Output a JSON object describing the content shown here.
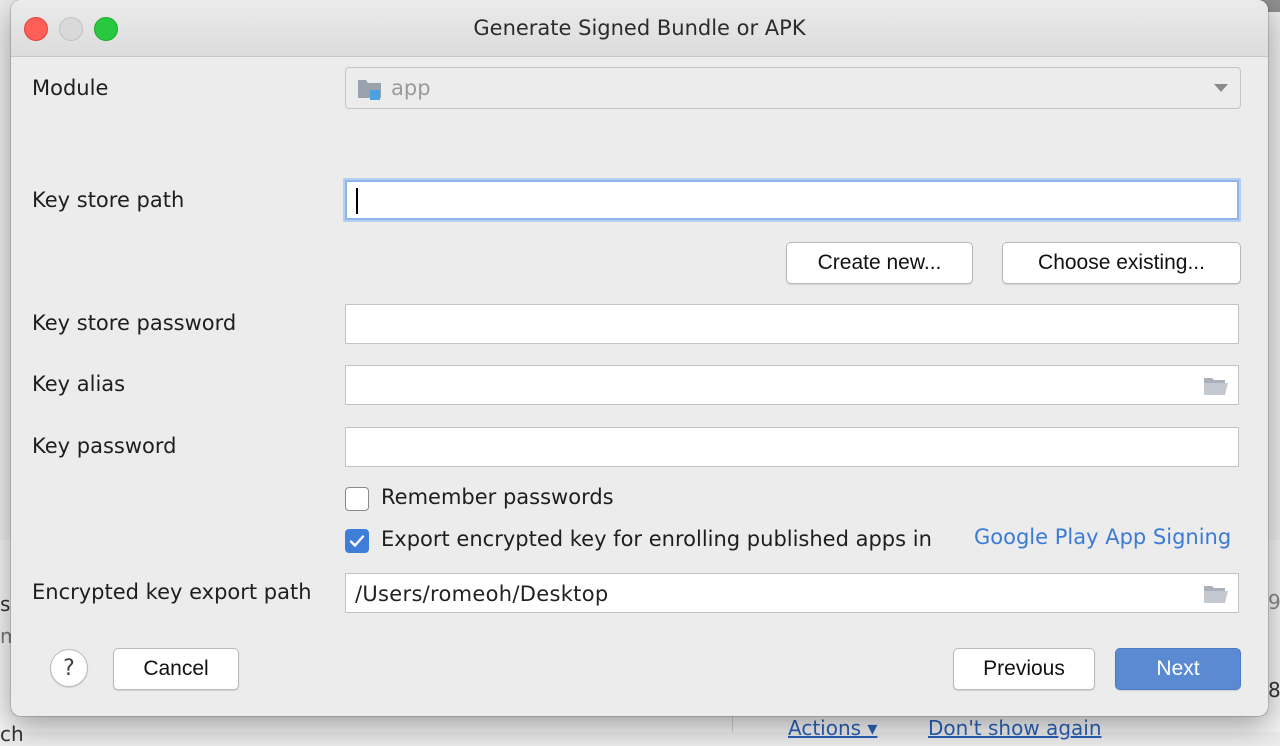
{
  "dialog": {
    "title": "Generate Signed Bundle or APK",
    "module": {
      "label": "Module",
      "value": "app"
    },
    "key_store_path": {
      "label": "Key store path",
      "value": ""
    },
    "buttons": {
      "create_new": "Create new...",
      "choose_existing": "Choose existing...",
      "cancel": "Cancel",
      "previous": "Previous",
      "next": "Next",
      "help": "?"
    },
    "key_store_password": {
      "label": "Key store password",
      "value": ""
    },
    "key_alias": {
      "label": "Key alias",
      "value": ""
    },
    "key_password": {
      "label": "Key password",
      "value": ""
    },
    "remember_passwords": {
      "label": "Remember passwords",
      "checked": false
    },
    "export_encrypted": {
      "label": "Export encrypted key for enrolling published apps in",
      "link": "Google Play App Signing",
      "checked": true
    },
    "export_path": {
      "label": "Encrypted key export path",
      "value": "/Users/romeoh/Desktop"
    }
  },
  "background": {
    "fragments": [
      "s",
      "m",
      "ch",
      "9",
      "8"
    ],
    "actions_link": "Actions ▾",
    "dont_show_link": "Don't show again"
  },
  "colors": {
    "accent": "#5a8bd2",
    "link": "#3b7bd6",
    "checkbox_on": "#3f7ed8"
  }
}
